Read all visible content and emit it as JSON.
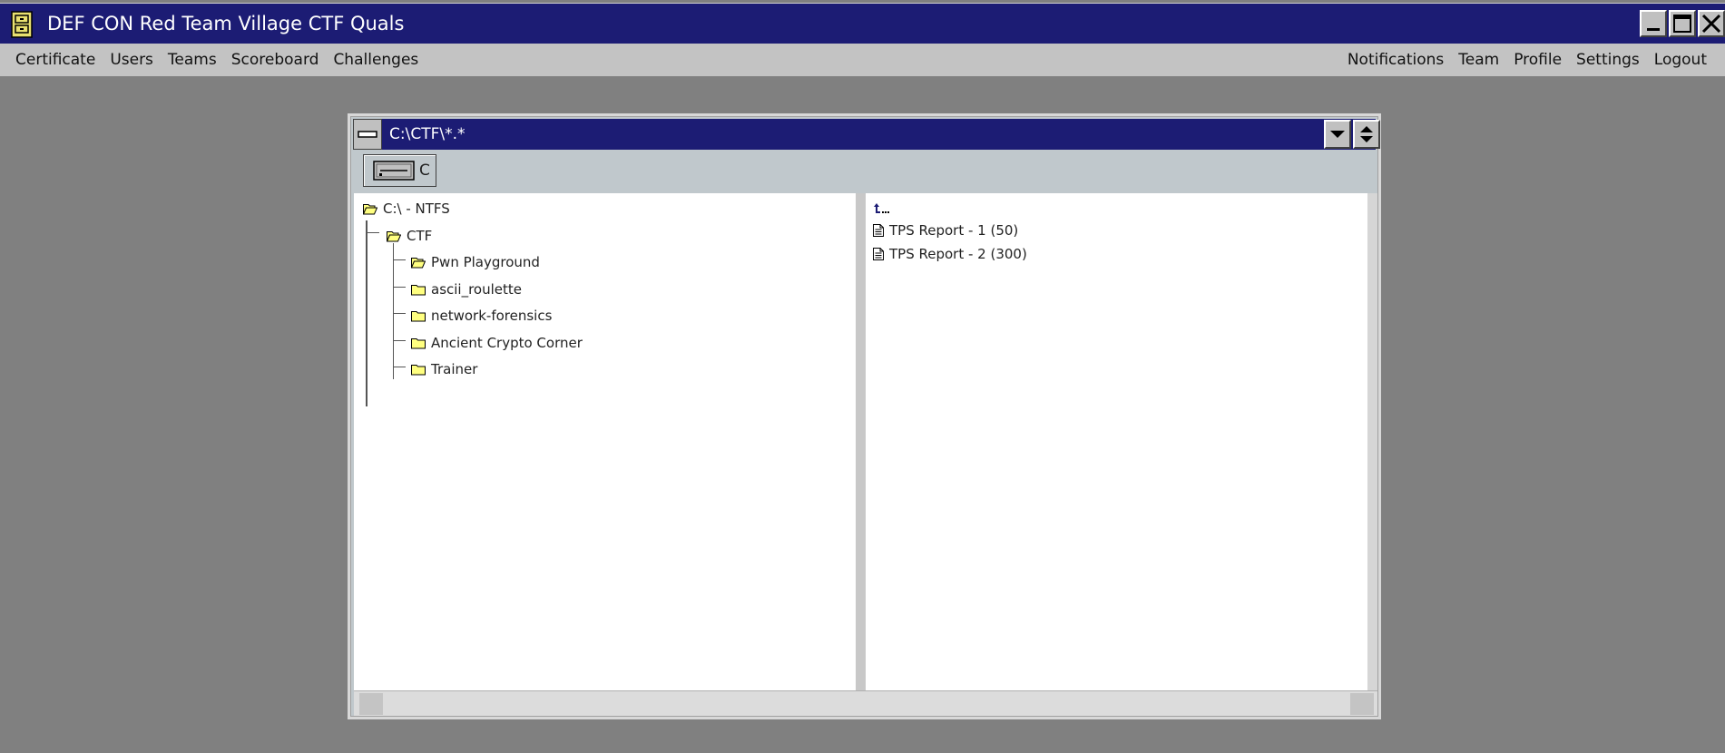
{
  "app": {
    "title": "DEF CON Red Team Village CTF Quals",
    "icon": "file-cabinet-icon"
  },
  "window_controls": [
    "minimize-icon",
    "maximize-icon",
    "close-icon"
  ],
  "menu": {
    "left": [
      {
        "label": "Certificate"
      },
      {
        "label": "Users"
      },
      {
        "label": "Teams"
      },
      {
        "label": "Scoreboard"
      },
      {
        "label": "Challenges"
      }
    ],
    "right": [
      {
        "label": "Notifications"
      },
      {
        "label": "Team"
      },
      {
        "label": "Profile"
      },
      {
        "label": "Settings"
      },
      {
        "label": "Logout"
      }
    ]
  },
  "file_manager": {
    "title": "C:\\CTF\\*.*",
    "drive": {
      "label": "C",
      "icon": "drive-icon"
    },
    "tree": {
      "root": {
        "label": "C:\\ - NTFS",
        "icon": "open-folder-icon"
      },
      "ctf": {
        "label": "CTF",
        "icon": "open-folder-icon"
      },
      "children": [
        {
          "label": "Pwn Playground",
          "icon": "open-folder-icon"
        },
        {
          "label": "ascii_roulette",
          "icon": "folder-icon"
        },
        {
          "label": "network-forensics",
          "icon": "folder-icon"
        },
        {
          "label": "Ancient Crypto Corner",
          "icon": "folder-icon"
        },
        {
          "label": "Trainer",
          "icon": "folder-icon"
        }
      ]
    },
    "files": {
      "up_icon": "parent-directory-icon",
      "items": [
        {
          "label": "TPS Report - 1 (50)",
          "icon": "document-icon"
        },
        {
          "label": "TPS Report - 2 (300)",
          "icon": "document-icon"
        }
      ]
    }
  },
  "colors": {
    "titlebar": "#1c1c74",
    "desktop": "#808080",
    "menubar": "#c3c3c3",
    "window_body": "#c0c8cc",
    "folder": "#ffff80"
  }
}
